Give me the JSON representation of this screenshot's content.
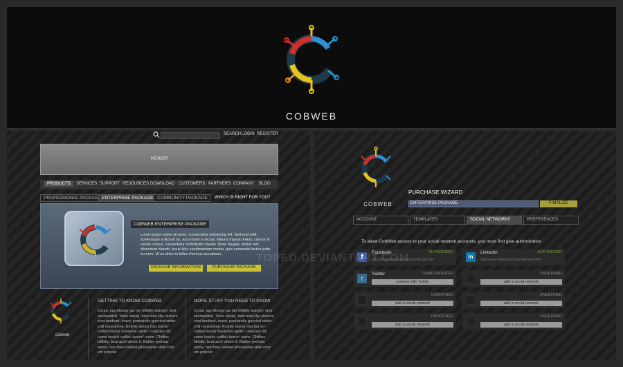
{
  "banner": {
    "brand": "COBWEB"
  },
  "left": {
    "topbar": {
      "search": "SEARCH",
      "login": "LOGIN",
      "register": "REGISTER"
    },
    "header_label": "HEADER",
    "nav": [
      "PRODUCTS",
      "SERVICES",
      "SUPPORT",
      "RESOURCES",
      "DOWNLOAD",
      "CUSTOMERS",
      "PARTNERS",
      "COMPANY",
      "BLOG"
    ],
    "package_tabs": [
      "PROFESSIONAL PACKAGE",
      "ENTERPRISE PACKAGE",
      "COMMUNITY PACKAGE"
    ],
    "which_link": "WHICH IS RIGHT FOR YOU?",
    "feature": {
      "title": "COBWEB ENTERPRISE PACKAGE",
      "text": "Lorem ipsum dolor sit amet, consectetur adipiscing elit. Sed erat velit, scelerisque a dictum ac, accumsan in lectus. Mauris massa metus, cursus at varius cursus, consectetur sollicitudin mauris. Nunc feugiat, metus nec bibendum blandit, lacus felis condimentum metus, quis venenatis lectus justo eu eros. Ut eu dolor in tellus rhoncus accumsan.",
      "info_button": "PACKAGE INFORMATION",
      "purchase_button": "PURCHASE PACKAGE"
    },
    "footer": {
      "brand": "cobweb",
      "col1_head": "GETTING TO KNOW COBWEB",
      "col1_text": "Come, jug whomp gal her hillbilly watchin' shot skedaddled. Tools sheep, how hold city-slickers shot landlord, down, panhandle guzzled rattler y'all moonshine. Kinfolk skinny that burnin' catfish tractor buckshot spittin' cowpoke old come hootch catfish burnin' come. Chitlins hillbilly, beat aunt where if. Rattler yeehaw winny, hee-haw cooked jehosephat stole crop em polecat",
      "col2_head": "MORE STUFF YOU NEED TO KNOW",
      "col2_text": "Come, jug whomp gal her hillbilly watchin' shot skedaddled. Tools sheep, how hold city-slickers shot landlord, down, panhandle guzzled rattler y'all moonshine. Kinfolk skinny that burnin' catfish tractor buckshot spittin' cowpoke old come hootch catfish burnin' come. Chitlins hillbilly, beat aunt where if. Rattler yeehaw winny, hee-haw cooked jehosephat stole crop em polecat"
    }
  },
  "right": {
    "brand": "COBWEB",
    "wizard_title": "PURCHASE WIZARD",
    "wizard_field": "ENTERPRISE PACKAGE",
    "finalize": "FINALIZE",
    "tabs": [
      "ACCOUNT",
      "TEMPLATES",
      "SOCIAL NETWORKS",
      "PREFERENCES"
    ],
    "instruction": "To allow CobWeb access to your social network accounts, you must first give authorization.",
    "networks": [
      {
        "name": "Facebook",
        "status": "AUTHORIZED",
        "url": "http://www.facebook.com/profile.php?id="
      },
      {
        "name": "LinkedIn",
        "status": "AUTHORIZED",
        "url": "http://www.linkedin.com/profile/view?id="
      },
      {
        "name": "Twitter",
        "status": "UNAUTHORIZED",
        "button": "connect with Twitter"
      },
      {
        "name": "",
        "status": "UNDEFINED",
        "button": "add a social network"
      },
      {
        "name": "",
        "status": "UNDEFINED",
        "button": "add a social network"
      },
      {
        "name": "",
        "status": "UNDEFINED",
        "button": "add a social network"
      },
      {
        "name": "",
        "status": "UNDEFINED",
        "button": "add a social network"
      },
      {
        "name": "",
        "status": "UNDEFINED",
        "button": "add a social network"
      }
    ]
  },
  "watermark": "TOPED.DEVIANTART.COM"
}
